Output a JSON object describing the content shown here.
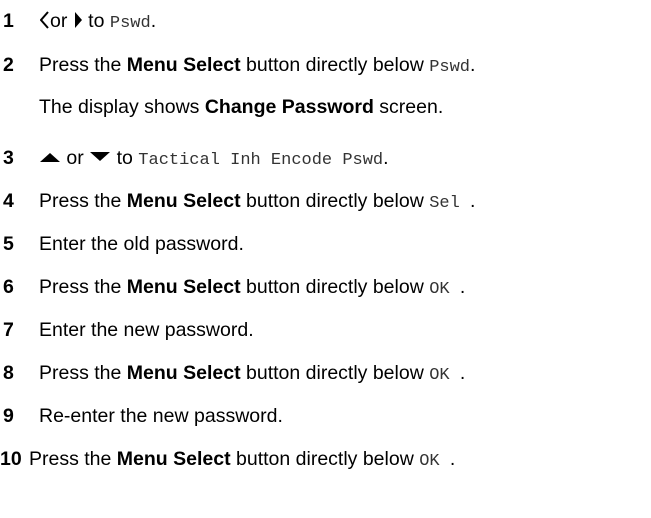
{
  "steps": [
    {
      "num": "1",
      "left_icon": "left-arrow-icon",
      "or": "or",
      "right_icon": "right-arrow-icon",
      "to": " to ",
      "target": "Pswd",
      "end": "."
    },
    {
      "num": "2",
      "pre": "Press the ",
      "bold": "Menu Select",
      "post": " button directly below ",
      "target": "Pswd",
      "end": "."
    },
    {
      "pre": "The display shows ",
      "bold": "Change Password",
      "post": " screen."
    },
    {
      "num": "3",
      "up_icon": "up-arrow-icon",
      "or": " or ",
      "down_icon": "down-arrow-icon",
      "to": " to ",
      "target": "Tactical Inh Encode Pswd",
      "end": "."
    },
    {
      "num": "4",
      "pre": "Press the ",
      "bold": "Menu Select",
      "post": " button directly below ",
      "target": "Sel ",
      "end": "."
    },
    {
      "num": "5",
      "text": "Enter the old password."
    },
    {
      "num": "6",
      "pre": "Press the ",
      "bold": "Menu Select",
      "post": " button directly below ",
      "target": "OK ",
      "end": "."
    },
    {
      "num": "7",
      "text": "Enter the new password."
    },
    {
      "num": "8",
      "pre": "Press the ",
      "bold": "Menu Select",
      "post": " button directly below ",
      "target": "OK ",
      "end": "."
    },
    {
      "num": "9",
      "text": "Re-enter the new password."
    },
    {
      "num": "10",
      "pre": "Press the ",
      "bold": "Menu Select",
      "post": " button directly below ",
      "target": "OK ",
      "end": "."
    }
  ]
}
